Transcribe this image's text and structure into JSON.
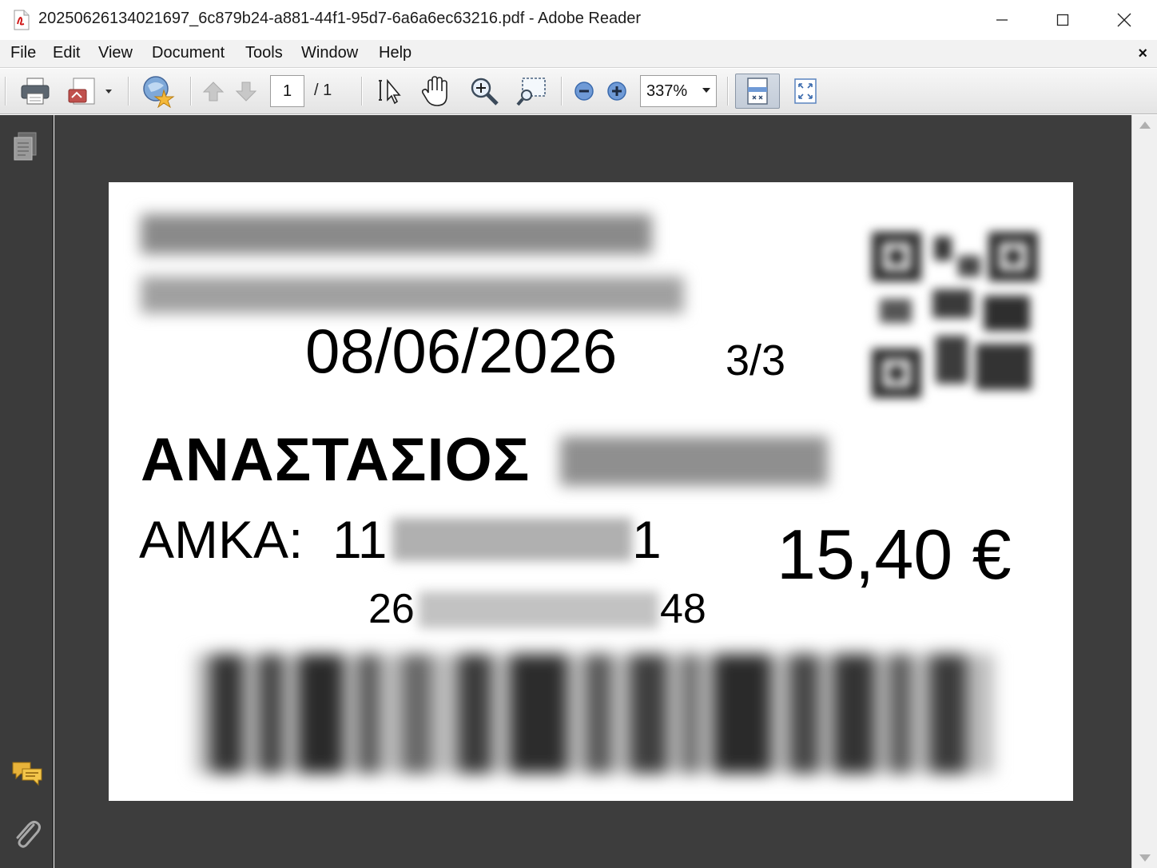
{
  "window": {
    "title": "20250626134021697_6c879b24-a881-44f1-95d7-6a6a6ec63216.pdf - Adobe Reader",
    "app_icon": "pdf-file-icon"
  },
  "menu": {
    "items": [
      "File",
      "Edit",
      "View",
      "Document",
      "Tools",
      "Window",
      "Help"
    ],
    "close_glyph": "×"
  },
  "toolbar": {
    "current_page": "1",
    "total_pages": "/ 1",
    "zoom": "337%",
    "icons": [
      "print-icon",
      "edit-share-icon",
      "collaborate-icon",
      "previous-page-icon",
      "next-page-icon",
      "select-tool-icon",
      "hand-tool-icon",
      "marquee-zoom-icon",
      "snapshot-icon",
      "zoom-out-icon",
      "zoom-in-icon",
      "fit-page-icon",
      "full-screen-icon"
    ]
  },
  "nav_pane": {
    "icons": [
      "pages-icon",
      "comments-icon",
      "attachments-icon"
    ]
  },
  "document": {
    "date": "08/06/2026",
    "page_count": "3/3",
    "first_name": "ΑΝΑΣΤΑΣΙΟΣ",
    "amka_label": "ΑΜΚΑ:",
    "amka_start": "11",
    "amka_end": "1",
    "amount": "15,40 €",
    "code_start": "26",
    "code_end": "48"
  },
  "colors": {
    "viewer_background": "#3d3d3d",
    "nav_pane": "#3b3b3b",
    "toolbar": "#e9e9e9",
    "page": "#ffffff"
  }
}
